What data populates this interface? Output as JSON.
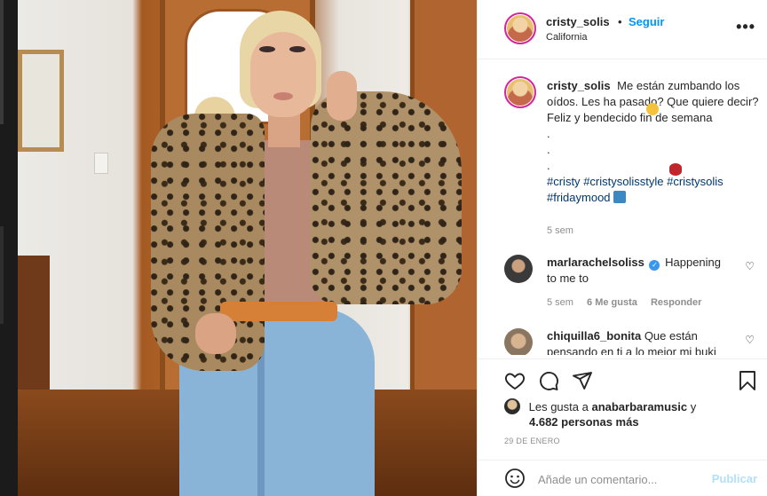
{
  "post": {
    "username": "cristy_solis",
    "follow_label": "Seguir",
    "separator": "•",
    "location": "California",
    "more_label": "•••"
  },
  "caption": {
    "username": "cristy_solis",
    "text": "Me están zumbando los oídos. Les ha pasado? Que quiere decir?",
    "line2": "Feliz y bendecido fin de semana",
    "dots": [
      ".",
      ".",
      "."
    ],
    "hashtags": [
      "#cristy",
      "#cristysolisstyle",
      "#cristysolis",
      "#fridaymood"
    ],
    "age": "5 sem"
  },
  "comments": [
    {
      "username": "marlarachelsoliss",
      "verified": true,
      "text": "Happening to me to",
      "age": "5 sem",
      "likes": "6 Me gusta",
      "reply": "Responder"
    },
    {
      "username": "chiquilla6_bonita",
      "text": "Que están pensando en ti a lo mejor mi buki"
    }
  ],
  "likes": {
    "prefix": "Les gusta a",
    "liker": "anabarbaramusic",
    "suffix": "y",
    "count": "4.682 personas más"
  },
  "date": "29 DE ENERO",
  "composer": {
    "placeholder": "Añade un comentario...",
    "publish_label": "Publicar"
  },
  "icons": {
    "like": "heart-icon",
    "comment": "comment-icon",
    "share": "paper-plane-icon",
    "save": "bookmark-icon",
    "emoji": "smiley-icon",
    "more": "ellipsis-icon",
    "verified": "verified-badge-icon"
  },
  "colors": {
    "link": "#0095f6",
    "hashtag": "#00376b",
    "muted": "#8e8e8e",
    "text": "#262626"
  }
}
